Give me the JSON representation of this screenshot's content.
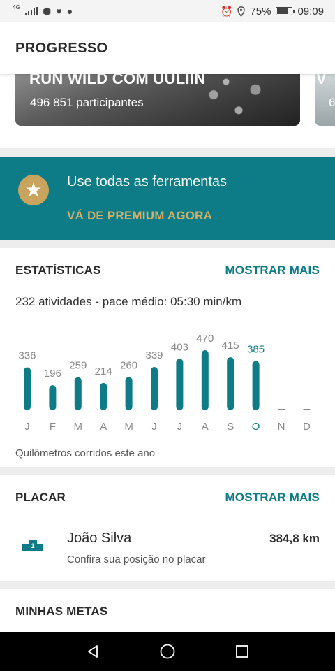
{
  "status_bar": {
    "network": "4G",
    "battery": "75%",
    "time": "09:09",
    "icons": [
      "signal-icon",
      "shield-icon",
      "heart-rate-icon",
      "chat-icon",
      "alarm-icon",
      "location-icon",
      "battery-icon"
    ]
  },
  "app_bar": {
    "title": "PROGRESSO"
  },
  "challenges": [
    {
      "title": "RUN WILD COM UULIIN",
      "participants": "496 851 participantes"
    },
    {
      "title": "V",
      "participants": "6"
    }
  ],
  "premium": {
    "title": "Use todas as ferramentas",
    "cta": "VÁ DE PREMIUM AGORA",
    "icon": "star-icon"
  },
  "stats": {
    "title": "ESTATÍSTICAS",
    "show_more": "MOSTRAR MAIS",
    "summary": "232 atividades - pace médio: 05:30 min/km",
    "caption": "Quilômetros corridos este ano"
  },
  "chart_data": {
    "type": "bar",
    "categories": [
      "J",
      "F",
      "M",
      "A",
      "M",
      "J",
      "J",
      "A",
      "S",
      "O",
      "N",
      "D"
    ],
    "values": [
      336,
      196,
      259,
      214,
      260,
      339,
      403,
      470,
      415,
      385,
      null,
      null
    ],
    "value_labels": [
      "336",
      "196",
      "259",
      "214",
      "260",
      "339",
      "403",
      "470",
      "415",
      "385",
      "",
      ""
    ],
    "highlight_index": 9,
    "ylim": [
      0,
      470
    ],
    "title": "",
    "xlabel": "",
    "ylabel": "",
    "grid": false,
    "colors": {
      "bar": "#0e7c86",
      "label": "#888888",
      "highlight_label": "#0e7c86",
      "empty": "#888888"
    }
  },
  "leaderboard": {
    "title": "PLACAR",
    "show_more": "MOSTRAR MAIS",
    "name": "João Silva",
    "distance": "384,8 km",
    "subtitle": "Confira sua posição no placar",
    "rank": "1",
    "icon": "podium-icon"
  },
  "goals": {
    "title": "MINHAS METAS"
  },
  "nav_bar": {
    "icons": [
      "back-icon",
      "home-icon",
      "recents-icon"
    ]
  },
  "colors": {
    "accent": "#0e7c86",
    "gold": "#c9a45e",
    "premium_cta": "#d4b06a"
  }
}
